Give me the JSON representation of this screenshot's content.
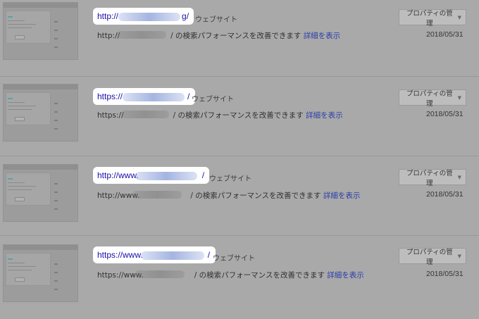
{
  "properties": [
    {
      "url_prefix": "http://",
      "url_suffix": "g/",
      "type_label": "ウェブサイト",
      "desc_prefix": "http://",
      "desc_text": "/ の検索パフォーマンスを改善できます",
      "detail_label": "詳細を表示",
      "manage_label": "プロパティの管理",
      "date": "2018/05/31"
    },
    {
      "url_prefix": "https://",
      "url_suffix": "/",
      "type_label": "ウェブサイト",
      "desc_prefix": "https://",
      "desc_text": "/ の検索パフォーマンスを改善できます",
      "detail_label": "詳細を表示",
      "manage_label": "プロパティの管理",
      "date": "2018/05/31"
    },
    {
      "url_prefix": "http://www.",
      "url_suffix": "/",
      "type_label": "ウェブサイト",
      "desc_prefix": "http://www.",
      "desc_text": "/ の検索パフォーマンスを改善できます",
      "detail_label": "詳細を表示",
      "manage_label": "プロパティの管理",
      "date": "2018/05/31"
    },
    {
      "url_prefix": "https://www.",
      "url_suffix": "/",
      "type_label": "ウェブサイト",
      "desc_prefix": "https://www.",
      "desc_text": "/ の検索パフォーマンスを改善できます",
      "detail_label": "詳細を表示",
      "manage_label": "プロパティの管理",
      "date": "2018/05/31"
    }
  ],
  "icons": {
    "dropdown": "chevron-down-icon"
  },
  "colors": {
    "overlay_bg": "#a9a9a9",
    "link": "#1a0dab",
    "highlight": "#ffffff"
  }
}
